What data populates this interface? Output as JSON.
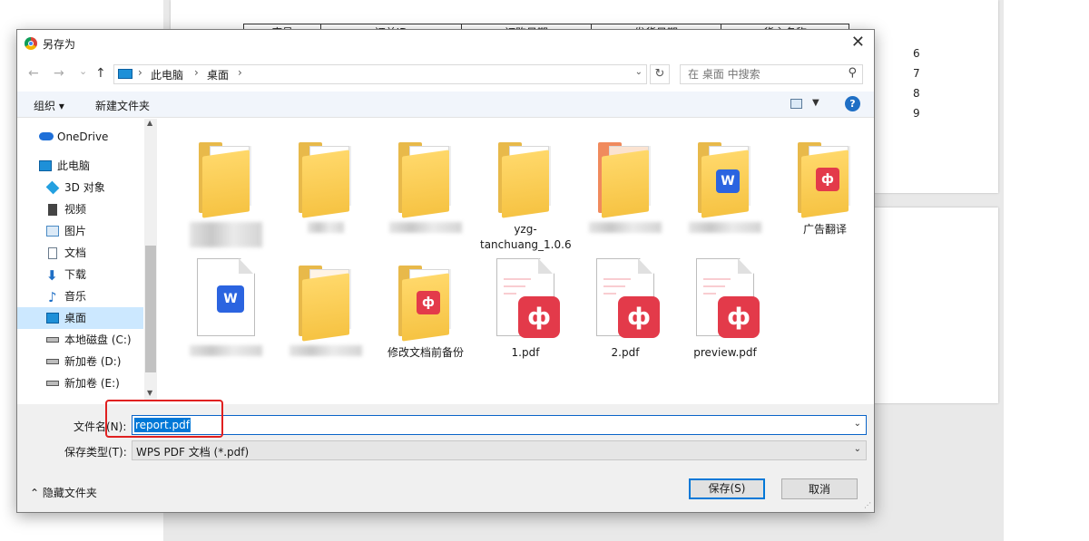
{
  "background": {
    "table_headers": [
      "序号",
      "订单ID",
      "订购日期",
      "发货日期",
      "货主名称"
    ],
    "row_numbers": [
      "6",
      "7",
      "8",
      "9"
    ]
  },
  "dialog": {
    "title": "另存为",
    "close": "✕",
    "address": {
      "crumbs": [
        "此电脑",
        "桌面"
      ],
      "separator": "›",
      "search_placeholder": "在 桌面 中搜索"
    },
    "nav": {
      "back": "←",
      "forward": "→",
      "recent": "⌄",
      "up": "↑",
      "refresh": "↻",
      "search_icon": "⚲"
    },
    "toolbar": {
      "organize": "组织 ▾",
      "new_folder": "新建文件夹",
      "help": "?"
    },
    "sidebar": {
      "items": [
        {
          "label": "OneDrive",
          "icon": "cloud-icon",
          "color": "#1e6fd8"
        },
        {
          "label": "此电脑",
          "icon": "computer-icon",
          "color": "#1e90d8"
        },
        {
          "label": "3D 对象",
          "icon": "cube-icon",
          "color": "#23a0e0"
        },
        {
          "label": "视频",
          "icon": "film-icon",
          "color": "#444444"
        },
        {
          "label": "图片",
          "icon": "picture-icon",
          "color": "#4a8ac4"
        },
        {
          "label": "文档",
          "icon": "document-icon",
          "color": "#6a7b8c"
        },
        {
          "label": "下载",
          "icon": "download-icon",
          "color": "#1f6fc5"
        },
        {
          "label": "音乐",
          "icon": "music-icon",
          "color": "#1f6fc5"
        },
        {
          "label": "桌面",
          "icon": "desktop-icon",
          "color": "#1e90d8",
          "selected": true
        },
        {
          "label": "本地磁盘 (C:)",
          "icon": "drive-c-icon",
          "color": "#555555"
        },
        {
          "label": "新加卷 (D:)",
          "icon": "drive-d-icon",
          "color": "#555555"
        },
        {
          "label": "新加卷 (E:)",
          "icon": "drive-e-icon",
          "color": "#555555"
        }
      ]
    },
    "files": [
      {
        "label": "",
        "kind": "folder",
        "blurred": true
      },
      {
        "label": "",
        "kind": "folder",
        "blurred": true
      },
      {
        "label": "",
        "kind": "folder",
        "blurred": true
      },
      {
        "label": "yzg-tanchuang_1.0.6",
        "kind": "folder"
      },
      {
        "label": "",
        "kind": "folder",
        "blurred": true
      },
      {
        "label": "",
        "kind": "folder-word",
        "blurred": true
      },
      {
        "label": "广告翻译",
        "kind": "folder-pdf"
      },
      {
        "label": "",
        "kind": "word-doc",
        "blurred": true
      },
      {
        "label": "",
        "kind": "folder",
        "blurred": true
      },
      {
        "label": "修改文档前备份",
        "kind": "folder-pdf"
      },
      {
        "label": "1.pdf",
        "kind": "pdf"
      },
      {
        "label": "2.pdf",
        "kind": "pdf"
      },
      {
        "label": "preview.pdf",
        "kind": "pdf"
      }
    ],
    "bottom": {
      "filename_label": "文件名(N):",
      "filename_value": "report.pdf",
      "filetype_label": "保存类型(T):",
      "filetype_value": "WPS PDF 文档 (*.pdf)",
      "hide_folders": "隐藏文件夹",
      "save": "保存(S)",
      "cancel": "取消"
    },
    "colors": {
      "accent": "#0078d7",
      "highlight": "#e02020",
      "folder": "#f6c343",
      "pdf": "#e33a4a",
      "word": "#2b64e0"
    }
  }
}
